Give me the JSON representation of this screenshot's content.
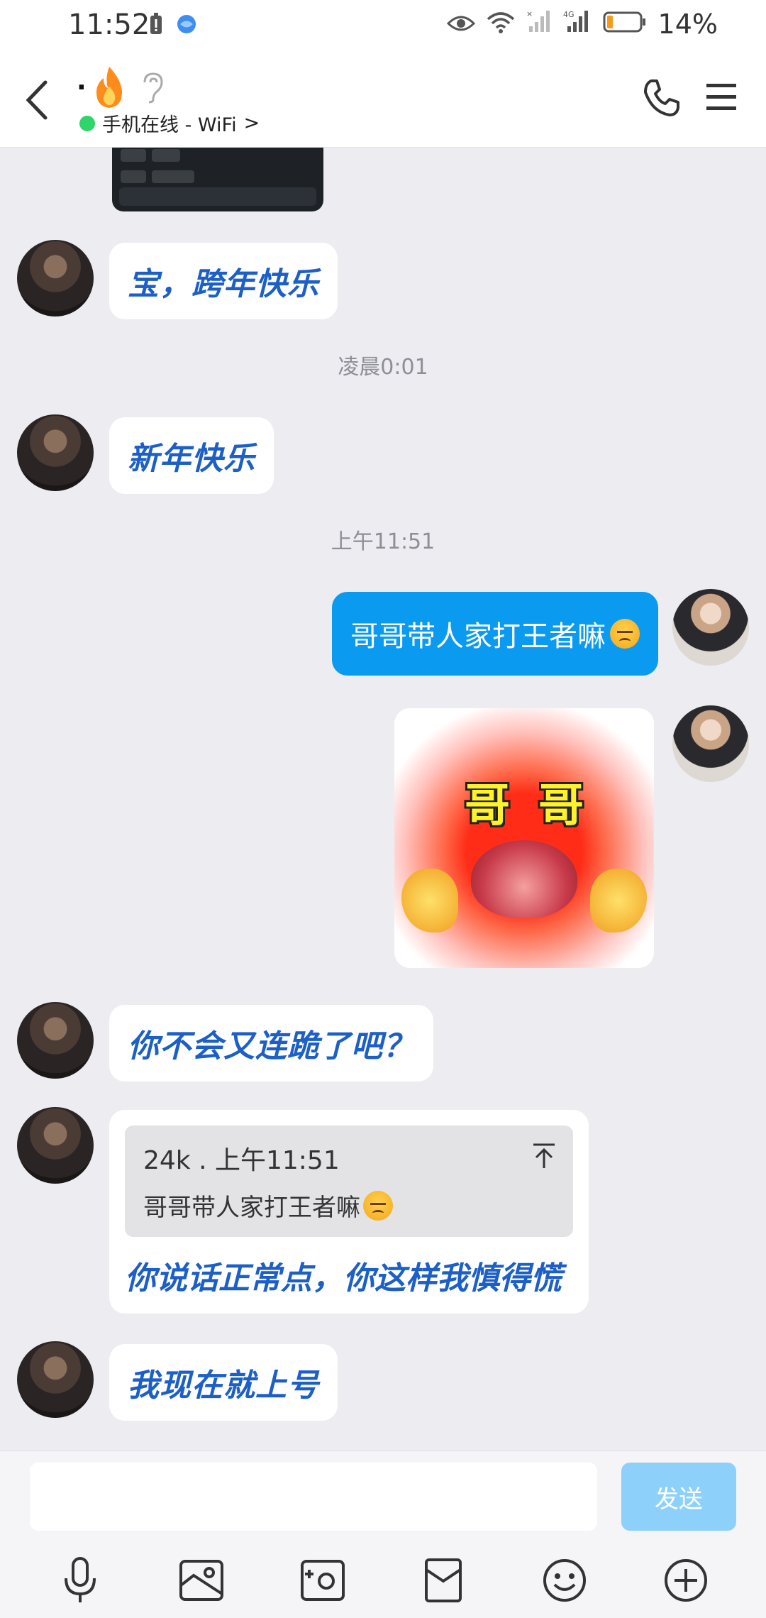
{
  "status_bar": {
    "time": "11:52",
    "network": "4G",
    "battery": "14%"
  },
  "header": {
    "contact_name": ".",
    "online_status": "手机在线 - WiFi",
    "chevron": ">"
  },
  "messages": [
    {
      "type": "incoming",
      "text": "宝，跨年快乐"
    },
    {
      "type": "time",
      "text": "凌晨0:01"
    },
    {
      "type": "incoming",
      "text": "新年快乐"
    },
    {
      "type": "time",
      "text": "上午11:51"
    },
    {
      "type": "outgoing",
      "text": "哥哥带人家打王者嘛"
    },
    {
      "type": "sticker",
      "text": "哥 哥"
    },
    {
      "type": "incoming",
      "text": "你不会又连跪了吧？"
    },
    {
      "type": "reply",
      "quote_sender": "24k",
      "quote_time": " . 上午11:51",
      "quote_text": "哥哥带人家打王者嘛",
      "text": "你说话正常点，你这样我慎得慌"
    },
    {
      "type": "incoming",
      "text": "我现在就上号"
    }
  ],
  "sticker_label": {
    "left": "哥",
    "right": "哥"
  },
  "input": {
    "placeholder": "",
    "send_label": "发送"
  },
  "colors": {
    "incoming_text": "#1c5fc7",
    "outgoing_bubble": "#0a9af0",
    "send_button": "#8dd1fb",
    "online_dot": "#2fd46b"
  },
  "toolbar": [
    "microphone-icon",
    "photo-icon",
    "camera-icon",
    "red-packet-icon",
    "emoji-icon",
    "plus-icon"
  ]
}
